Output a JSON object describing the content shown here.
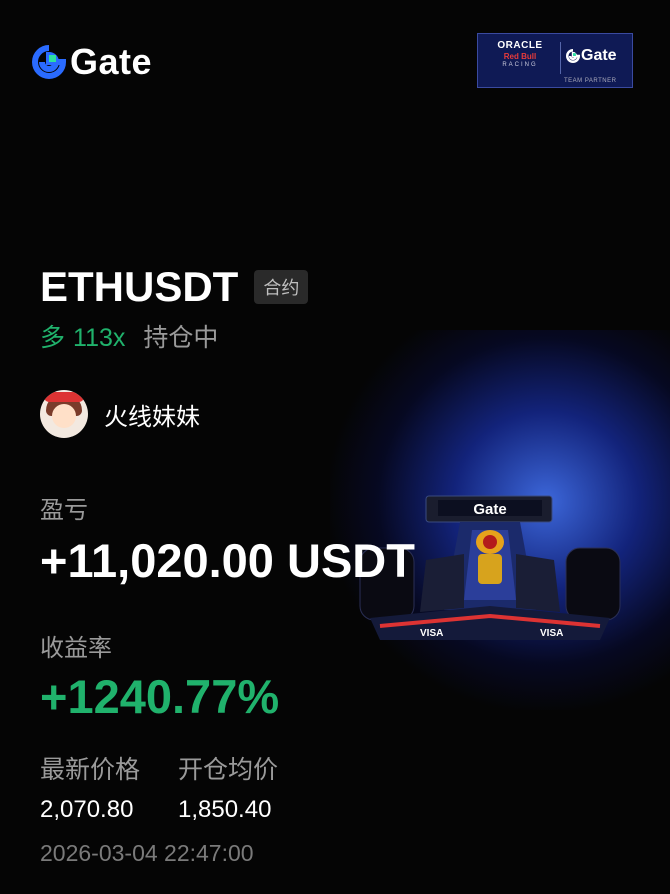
{
  "brand": {
    "name": "Gate"
  },
  "partner": {
    "oracle": "ORACLE",
    "redbull": "Red Bull",
    "racing": "RACING",
    "gate": "Gate",
    "tagline": "TEAM PARTNER"
  },
  "position": {
    "symbol": "ETHUSDT",
    "type_badge": "合约",
    "side": "多",
    "leverage": "113x",
    "status": "持仓中"
  },
  "user": {
    "name": "火线妹妹"
  },
  "pnl": {
    "label": "盈亏",
    "value": "+11,020.00 USDT"
  },
  "roi": {
    "label": "收益率",
    "value": "+1240.77%"
  },
  "prices": {
    "latest_label": "最新价格",
    "entry_label": "开仓均价",
    "latest_value": "2,070.80",
    "entry_value": "1,850.40"
  },
  "timestamp": "2026-03-04 22:47:00",
  "colors": {
    "accent_green": "#20b26c",
    "brand_blue": "#2354e6",
    "background": "#050505"
  }
}
